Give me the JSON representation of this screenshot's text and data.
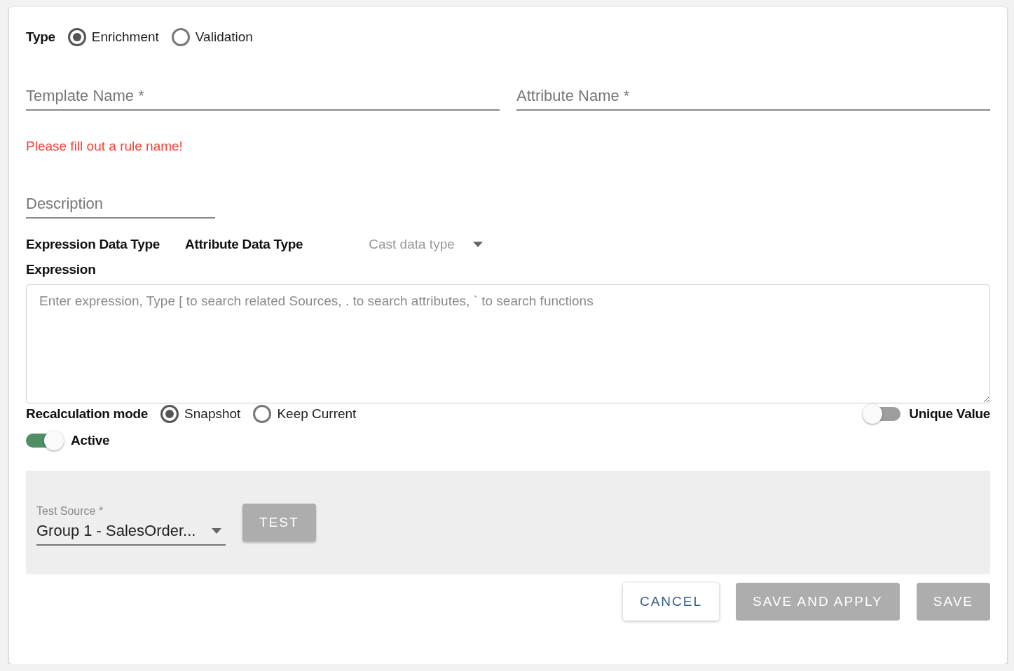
{
  "type_group": {
    "label": "Type",
    "options": [
      {
        "label": "Enrichment",
        "selected": true
      },
      {
        "label": "Validation",
        "selected": false
      }
    ]
  },
  "fields": [
    {
      "placeholder": "Template Name *"
    },
    {
      "placeholder": "Attribute Name *"
    }
  ],
  "error": "Please fill out a rule name!",
  "description": {
    "placeholder": "Description"
  },
  "data_types": {
    "expression_label": "Expression Data Type",
    "attribute_label": "Attribute Data Type",
    "cast_select": {
      "placeholder": "Cast data type"
    }
  },
  "expression": {
    "label": "Expression",
    "placeholder": "Enter expression, Type [ to search related Sources, . to search attributes, ` to search functions"
  },
  "recalculation": {
    "label": "Recalculation mode",
    "options": [
      {
        "label": "Snapshot",
        "selected": true
      },
      {
        "label": "Keep Current",
        "selected": false
      }
    ]
  },
  "unique_value": {
    "label": "Unique Value",
    "on": false
  },
  "active": {
    "label": "Active",
    "on": true
  },
  "test_panel": {
    "source_label": "Test Source *",
    "source_value": "Group 1 - SalesOrder...",
    "test_button": {
      "label": "TEST",
      "disabled": true
    }
  },
  "buttons": [
    {
      "kind": "outlined",
      "label": "CANCEL",
      "disabled": false
    },
    {
      "kind": "contained",
      "label": "SAVE AND APPLY",
      "disabled": true
    },
    {
      "kind": "contained",
      "label": "SAVE",
      "disabled": true
    }
  ]
}
